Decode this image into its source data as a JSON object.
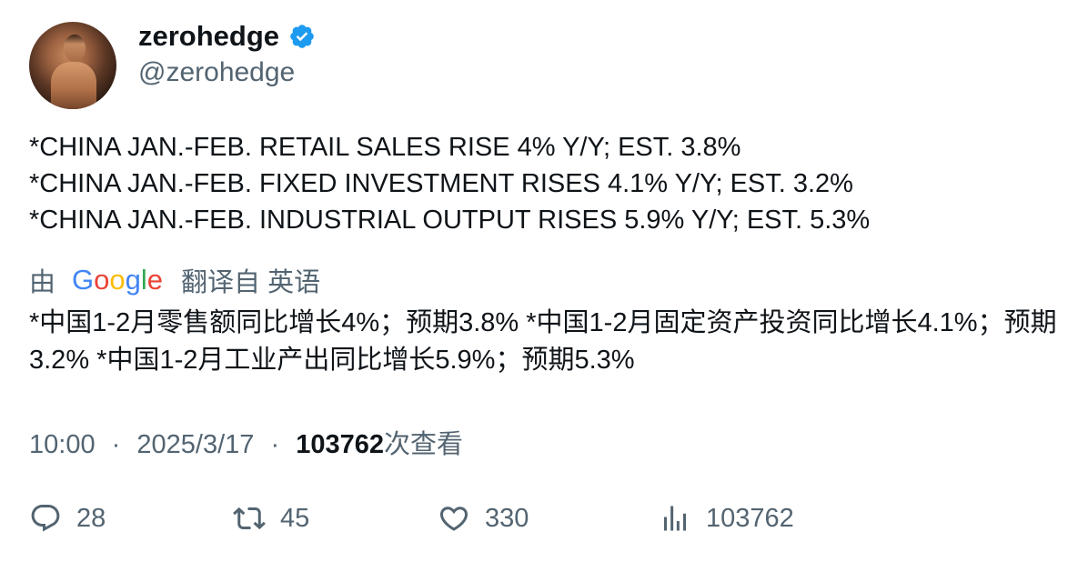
{
  "author": {
    "name": "zerohedge",
    "handle": "@zerohedge",
    "verified_color": "#1d9bf0"
  },
  "tweet": {
    "lines": [
      "*CHINA JAN.-FEB. RETAIL SALES RISE 4% Y/Y; EST. 3.8%",
      "*CHINA JAN.-FEB. FIXED INVESTMENT RISES 4.1% Y/Y; EST. 3.2%",
      "*CHINA JAN.-FEB. INDUSTRIAL OUTPUT RISES 5.9% Y/Y; EST. 5.3%"
    ]
  },
  "translation": {
    "by_label": "由",
    "provider": "Google",
    "action_label": "翻译自 英语",
    "text": "*中国1-2月零售额同比增长4%；预期3.8% *中国1-2月固定资产投资同比增长4.1%；预期3.2% *中国1-2月工业产出同比增长5.9%；预期5.3%"
  },
  "meta": {
    "time": "10:00",
    "separator": "·",
    "date": "2025/3/17",
    "views_count": "103762",
    "views_label": "次查看"
  },
  "actions": {
    "replies": "28",
    "reposts": "45",
    "likes": "330",
    "views": "103762"
  },
  "icons": {
    "reply": "reply-icon",
    "repost": "repost-icon",
    "like": "heart-icon",
    "views": "analytics-icon",
    "verified": "verified-badge-icon"
  }
}
